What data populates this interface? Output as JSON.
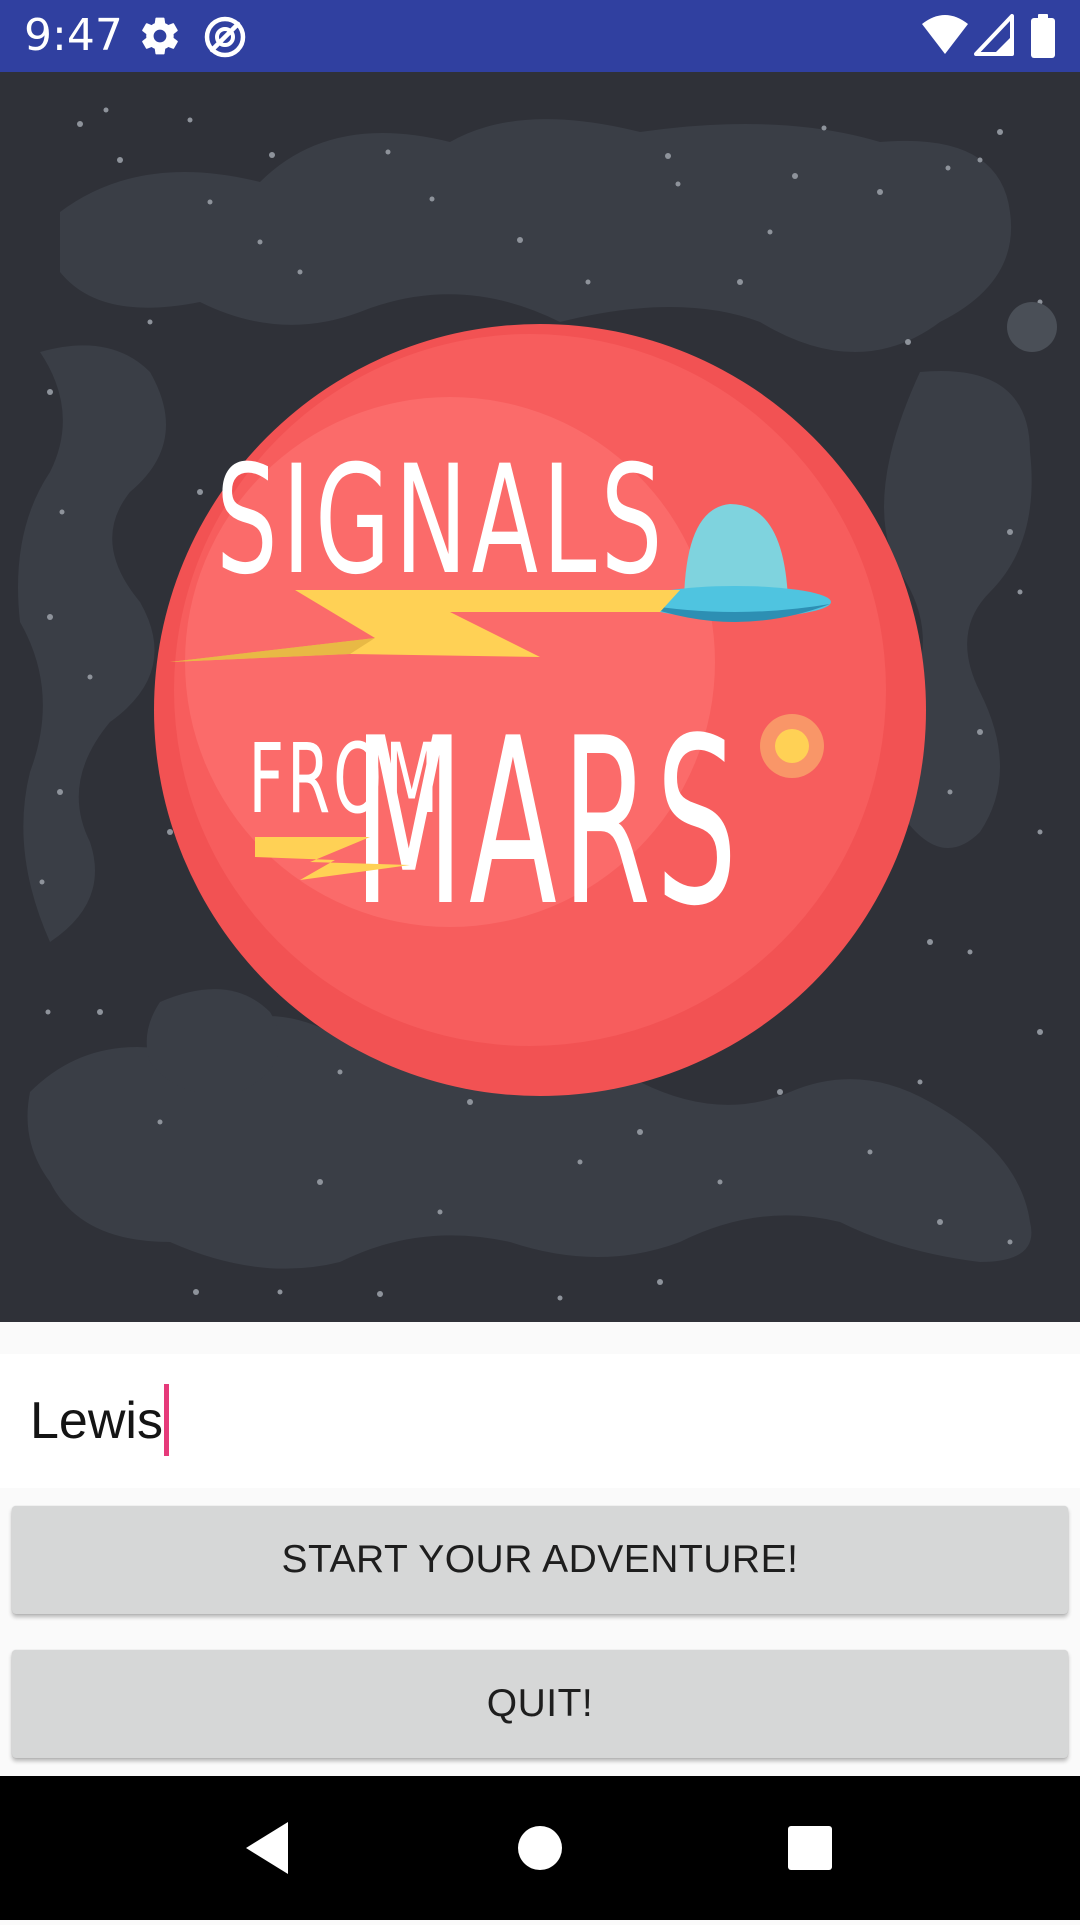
{
  "status_bar": {
    "time": "9:47",
    "icons": [
      "gear-icon",
      "data-saver-icon",
      "wifi-icon",
      "cell-signal-icon",
      "battery-icon"
    ],
    "background": "#3040a0"
  },
  "hero": {
    "logo_words": [
      "SIGNALS",
      "FROM",
      "MARS"
    ],
    "colors": {
      "space": "#2f3138",
      "nebula": "#3a3e46",
      "planet": "#f25253",
      "planet_light": "#fb6d6c",
      "bolt": "#ffd155",
      "ufo_dome": "#7fd3de",
      "ufo_disc": "#39a9cc"
    }
  },
  "form": {
    "name_value": "Lewis",
    "start_label": "START YOUR ADVENTURE!",
    "quit_label": "QUIT!"
  },
  "nav_bar": {
    "icons": [
      "back-icon",
      "home-icon",
      "recents-icon"
    ]
  }
}
